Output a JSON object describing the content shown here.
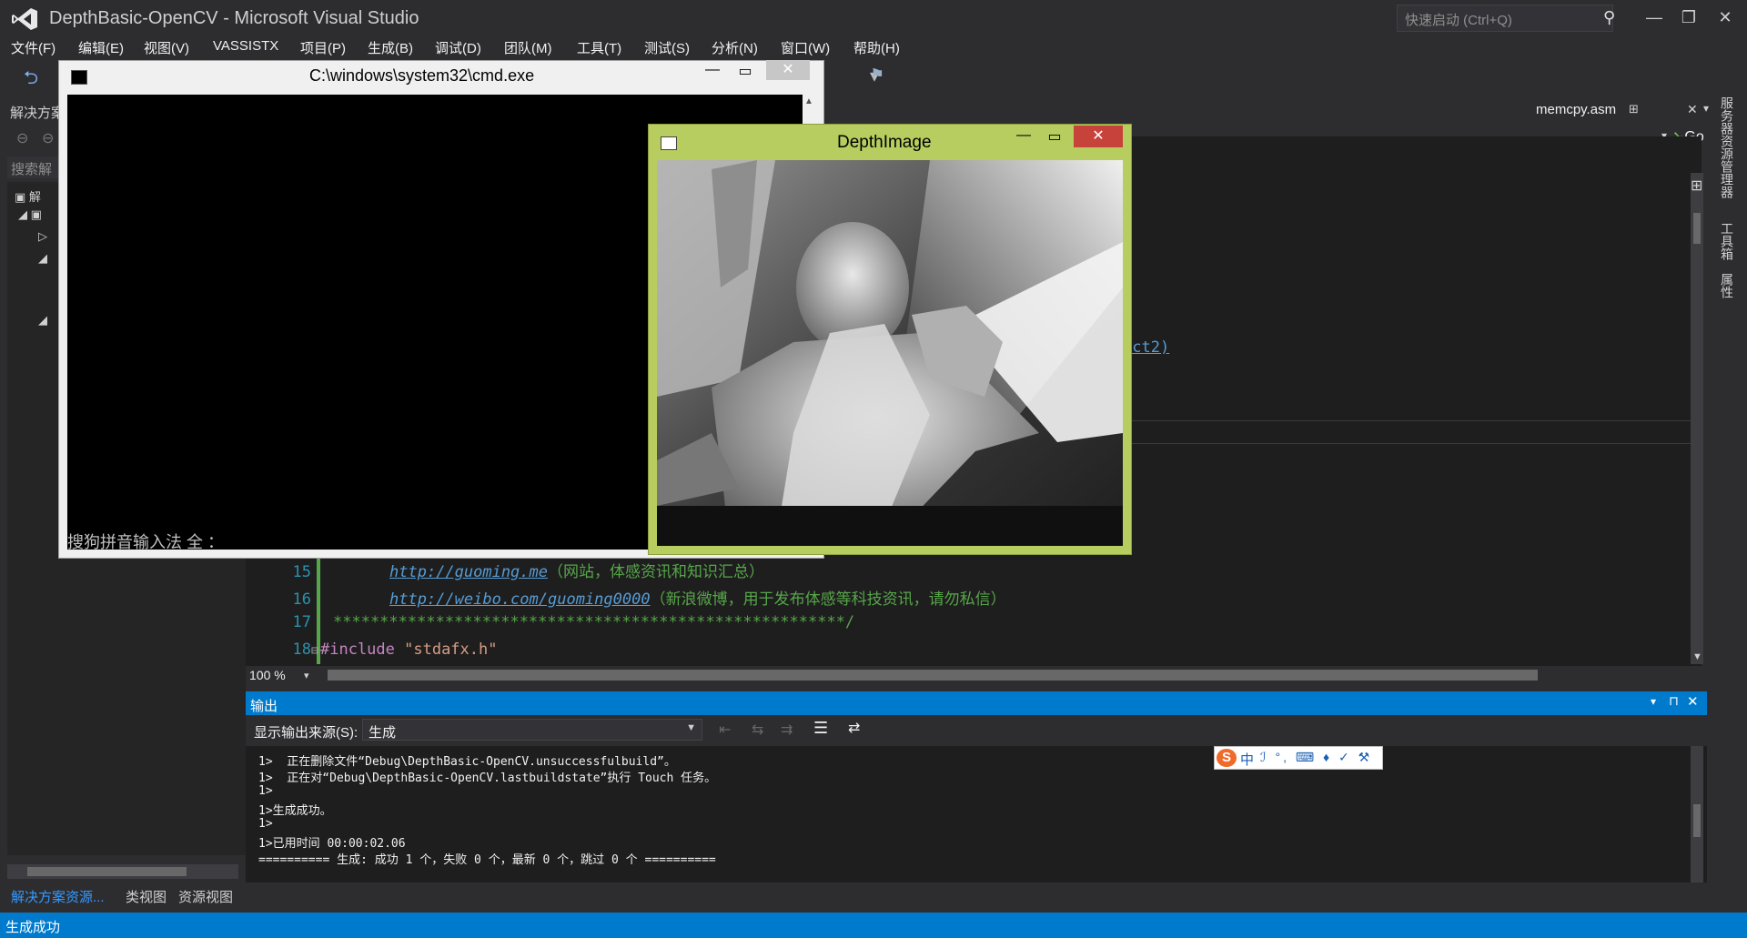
{
  "window": {
    "title": "DepthBasic-OpenCV - Microsoft Visual Studio",
    "quick_launch_placeholder": "快速启动 (Ctrl+Q)"
  },
  "menu": [
    "文件(F)",
    "编辑(E)",
    "视图(V)",
    "VASSISTX",
    "项目(P)",
    "生成(B)",
    "调试(D)",
    "团队(M)",
    "工具(T)",
    "测试(S)",
    "分析(N)",
    "窗口(W)",
    "帮助(H)"
  ],
  "solution_panel": {
    "title": "解决方案",
    "search_placeholder": "搜索解",
    "tree_root": "解",
    "tabs": [
      "解决方案资源...",
      "类视图",
      "资源视图"
    ]
  },
  "editor": {
    "tab_file": "memcpy.asm",
    "go_label": "Go",
    "partial_text": "ect2)",
    "zoom": "100 %",
    "lines": [
      {
        "num": "15",
        "link": "http://guoming.me",
        "comment": "（网站，体感资讯和知识汇总）"
      },
      {
        "num": "16",
        "link": "http://weibo.com/guoming0000",
        "comment": "（新浪微博，用于发布体感等科技资讯，请勿私信）"
      },
      {
        "num": "17",
        "text": "*******************************************************/"
      },
      {
        "num": "18",
        "kw": "#include ",
        "str": "\"stdafx.h\""
      }
    ]
  },
  "output": {
    "title": "输出",
    "source_label": "显示输出来源(S):",
    "source_value": "生成",
    "lines": [
      "1>  正在删除文件“Debug\\DepthBasic-OpenCV.unsuccessfulbuild”。",
      "1>  正在对“Debug\\DepthBasic-OpenCV.lastbuildstate”执行 Touch 任务。",
      "1>",
      "1>生成成功。",
      "1>",
      "1>已用时间 00:00:02.06",
      "========== 生成: 成功 1 个，失败 0 个，最新 0 个，跳过 0 个 =========="
    ]
  },
  "right_dock": [
    "服务器资源管理器",
    "工具箱",
    "属性"
  ],
  "status": "生成成功",
  "cmd_window": {
    "title": "C:\\windows\\system32\\cmd.exe",
    "ime_text": "搜狗拼音输入法 全 ："
  },
  "depth_window": {
    "title": "DepthImage"
  },
  "ime_bar": {
    "logo": "S",
    "mode": "中",
    "icons": "ℐ °, ⌨ ♦ ✓ ⚒"
  },
  "colors": {
    "accent": "#007acc",
    "depth_frame": "#b7cd5f",
    "close_red": "#c7423a"
  }
}
